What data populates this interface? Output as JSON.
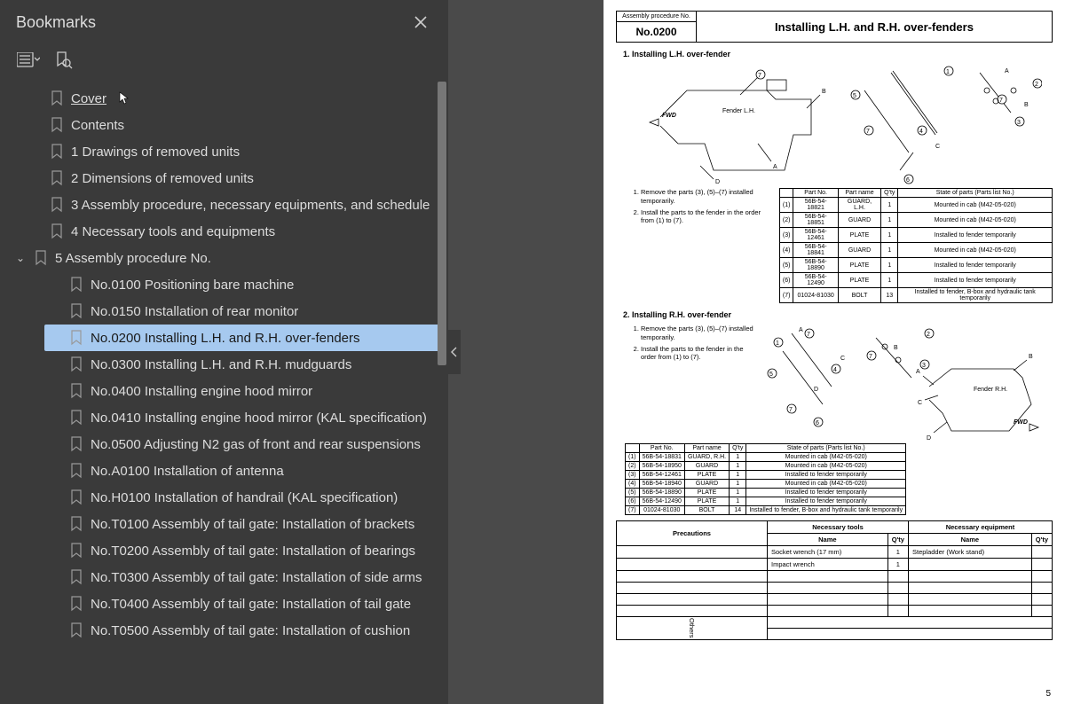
{
  "sidebar": {
    "title": "Bookmarks",
    "items": [
      {
        "label": "Cover",
        "hovered": true
      },
      {
        "label": "Contents"
      },
      {
        "label": "1 Drawings of removed units"
      },
      {
        "label": "2 Dimensions of removed units"
      },
      {
        "label": "3 Assembly procedure, necessary equipments, and schedule"
      },
      {
        "label": "4 Necessary tools and equipments"
      },
      {
        "label": "5 Assembly procedure No.",
        "expanded": true,
        "children": [
          {
            "label": "No.0100  Positioning bare machine"
          },
          {
            "label": "No.0150  Installation of rear monitor"
          },
          {
            "label": "No.0200  Installing L.H. and R.H. over-fenders",
            "selected": true
          },
          {
            "label": "No.0300  Installing L.H. and R.H. mudguards"
          },
          {
            "label": "No.0400  Installing engine hood mirror"
          },
          {
            "label": "No.0410  Installing engine hood mirror (KAL specification)"
          },
          {
            "label": "No.0500  Adjusting N2 gas of front and rear suspensions"
          },
          {
            "label": "No.A0100  Installation of antenna"
          },
          {
            "label": "No.H0100  Installation of handrail  (KAL specification)"
          },
          {
            "label": "No.T0100  Assembly of tail gate: Installation of brackets"
          },
          {
            "label": "No.T0200  Assembly of tail gate: Installation of bearings"
          },
          {
            "label": "No.T0300  Assembly of tail gate: Installation of side arms"
          },
          {
            "label": "No.T0400  Assembly of tail gate: Installation of tail gate"
          },
          {
            "label": "No.T0500  Assembly of tail gate: Installation of cushion"
          }
        ]
      }
    ]
  },
  "doc": {
    "proc_label": "Assembly procedure No.",
    "proc_no": "No.0200",
    "title": "Installing L.H. and R.H. over-fenders",
    "sec1_h": "1.  Installing L.H. over-fender",
    "sec2_h": "2.  Installing R.H. over-fender",
    "step1": "Remove the parts (3), (5)–(7) installed temporarily.",
    "step2": "Install the parts to the fender in the order from (1) to (7).",
    "step2b": "Install the parts to the fender in the order from (1) to (7).",
    "parts_headers": [
      "",
      "Part No.",
      "Part name",
      "Q'ty",
      "State of parts (Parts list No.)"
    ],
    "parts1": [
      [
        "(1)",
        "56B-54-18821",
        "GUARD, L.H.",
        "1",
        "Mounted in cab (M42-05-020)"
      ],
      [
        "(2)",
        "56B-54-18851",
        "GUARD",
        "1",
        "Mounted in cab (M42-05-020)"
      ],
      [
        "(3)",
        "56B-54-12461",
        "PLATE",
        "1",
        "Installed to fender temporarily"
      ],
      [
        "(4)",
        "56B-54-18841",
        "GUARD",
        "1",
        "Mounted in cab (M42-05-020)"
      ],
      [
        "(5)",
        "56B-54-18890",
        "PLATE",
        "1",
        "Installed to fender temporarily"
      ],
      [
        "(6)",
        "56B-54-12490",
        "PLATE",
        "1",
        "Installed to fender temporarily"
      ],
      [
        "(7)",
        "01024-81030",
        "BOLT",
        "13",
        "Installed to fender, B-box and hydraulic tank temporarily"
      ]
    ],
    "parts2": [
      [
        "(1)",
        "56B-54-18831",
        "GUARD, R.H.",
        "1",
        "Mounted in cab (M42-05-020)"
      ],
      [
        "(2)",
        "56B-54-18950",
        "GUARD",
        "1",
        "Mounted in cab (M42-05-020)"
      ],
      [
        "(3)",
        "56B-54-12461",
        "PLATE",
        "1",
        "Installed to fender temporarily"
      ],
      [
        "(4)",
        "56B-54-18940",
        "GUARD",
        "1",
        "Mounted in cab (M42-05-020)"
      ],
      [
        "(5)",
        "56B-54-18890",
        "PLATE",
        "1",
        "Installed to fender temporarily"
      ],
      [
        "(6)",
        "56B-54-12490",
        "PLATE",
        "1",
        "Installed to fender temporarily"
      ],
      [
        "(7)",
        "01024-81030",
        "BOLT",
        "14",
        "Installed to fender, B-box and hydraulic tank temporarily"
      ]
    ],
    "bottom_headers": [
      "Precautions",
      "Necessary tools",
      "Necessary equipment"
    ],
    "sub_headers": [
      "Name",
      "Q'ty",
      "Name",
      "Q'ty"
    ],
    "tools": [
      [
        "Socket wrench (17 mm)",
        "1",
        "Stepladder (Work stand)",
        ""
      ],
      [
        "Impact wrench",
        "1",
        "",
        ""
      ]
    ],
    "others_label": "Others",
    "page_num": "5",
    "fender_lh": "Fender L.H.",
    "fender_rh": "Fender R.H.",
    "fwd": "FWD"
  }
}
